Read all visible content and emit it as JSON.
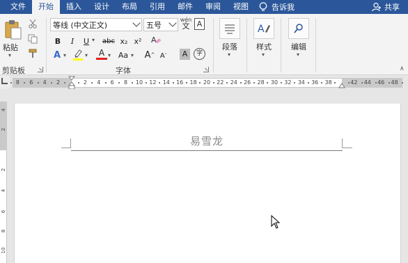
{
  "tabs": [
    {
      "label": "文件",
      "active": false
    },
    {
      "label": "开始",
      "active": true
    },
    {
      "label": "插入",
      "active": false
    },
    {
      "label": "设计",
      "active": false
    },
    {
      "label": "布局",
      "active": false
    },
    {
      "label": "引用",
      "active": false
    },
    {
      "label": "邮件",
      "active": false
    },
    {
      "label": "审阅",
      "active": false
    },
    {
      "label": "视图",
      "active": false
    }
  ],
  "tell_me": "告诉我",
  "share": "共享",
  "clipboard": {
    "paste": "粘贴",
    "group_label": "剪贴板"
  },
  "font": {
    "family_value": "等线 (中文正文)",
    "size_value": "五号",
    "pinyin_top": "wén",
    "pinyin_bottom": "文",
    "border_char": "A",
    "bold": "B",
    "italic": "I",
    "underline": "U",
    "strike": "abc",
    "subscript": "x₂",
    "superscript": "x²",
    "text_effect": "A",
    "font_color": "A",
    "change_case": "Aa",
    "grow": "A",
    "shrink": "A",
    "char_shading": "A",
    "enclose": "字",
    "group_label": "字体"
  },
  "paragraph": {
    "label": "段落"
  },
  "styles": {
    "label": "样式"
  },
  "editing": {
    "label": "编辑"
  },
  "ruler": {
    "h_numbers_left": [
      "8",
      "6",
      "4",
      "2"
    ],
    "h_numbers": [
      "2",
      "4",
      "6",
      "8",
      "10",
      "12",
      "14",
      "16",
      "18",
      "20",
      "22",
      "24",
      "26",
      "28",
      "30",
      "32",
      "34",
      "36",
      "38"
    ],
    "h_numbers_right": [
      "42",
      "44",
      "46",
      "48"
    ],
    "v_numbers": [
      "4",
      "2",
      "2",
      "4",
      "6",
      "8",
      "10"
    ]
  },
  "document": {
    "header_text": "易雪龙"
  },
  "colors": {
    "tab_bar": "#2b579a",
    "ribbon": "#f3f3f3",
    "highlight": "#ffff00",
    "font_color": "#e02020"
  }
}
